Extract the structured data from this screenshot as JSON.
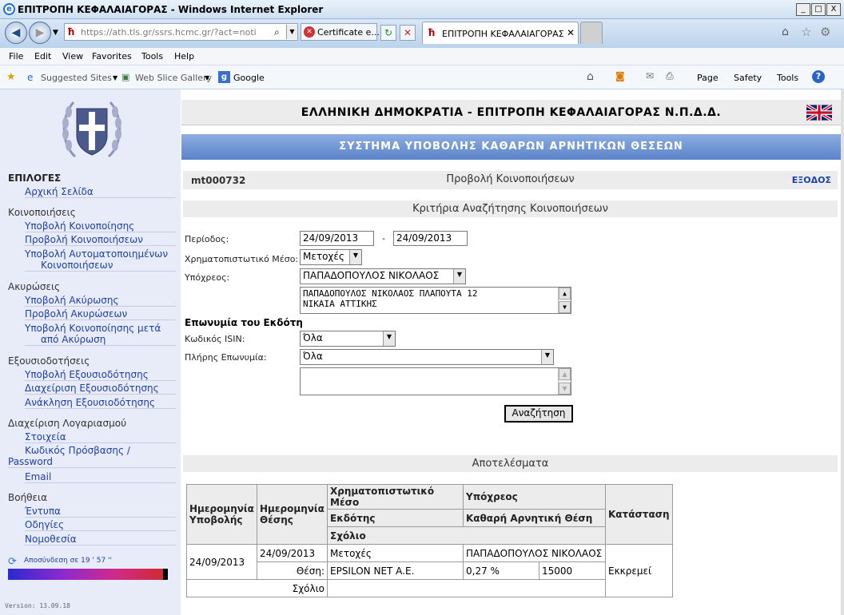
{
  "window": {
    "title": "ΕΠΙΤΡΟΠΗ ΚΕΦΑΛΑΙΑΓΟΡΑΣ - Windows Internet Explorer",
    "minimize": "_",
    "maximize": "□",
    "close": "X"
  },
  "browser": {
    "address": "https://ath.tls.gr/ssrs.hcmc.gr/?act=notification_",
    "certificate_label": "Certificate e...",
    "tab_label": "ΕΠΙΤΡΟΠΗ ΚΕΦΑΛΑΙΑΓΟΡΑΣ",
    "menu": [
      "File",
      "Edit",
      "View",
      "Favorites",
      "Tools",
      "Help"
    ],
    "favorites": [
      "Suggested Sites",
      "Web Slice Gallery",
      "Google"
    ],
    "toolbar": [
      "Page",
      "Safety",
      "Tools"
    ]
  },
  "site": {
    "banner": "ΕΛΛΗΝΙΚΗ ΔΗΜΟΚΡΑΤΙΑ - ΕΠΙΤΡΟΠΗ ΚΕΦΑΛΑΙΑΓΟΡΑΣ Ν.Π.Δ.Δ.",
    "system_title": "ΣΥΣΤΗΜΑ ΥΠΟΒΟΛΗΣ ΚΑΘΑΡΩΝ ΑΡΝΗΤΙΚΩΝ ΘΕΣΕΩΝ"
  },
  "sidebar": {
    "heading": "ΕΠΙΛΟΓΕΣ",
    "home": "Αρχική Σελίδα",
    "notifications_head": "Κοινοποιήσεις",
    "notif_submit": "Υποβολή Κοινοποίησης",
    "notif_view": "Προβολή Κοινοποιήσεων",
    "notif_auto_1": "Υποβολή Αυτοματοποιημένων",
    "notif_auto_2": "Κοινοποιήσεων",
    "cancel_head": "Ακυρώσεις",
    "cancel_submit": "Υποβολή Ακύρωσης",
    "cancel_view": "Προβολή Ακυρώσεων",
    "cancel_after_1": "Υποβολή Κοινοποίησης μετά",
    "cancel_after_2": "από Ακύρωση",
    "auth_head": "Εξουσιοδοτήσεις",
    "auth_submit": "Υποβολή Εξουσιοδότησης",
    "auth_manage": "Διαχείριση Εξουσιοδότησης",
    "auth_revoke": "Ανάκληση Εξουσιοδότησης",
    "account_head": "Διαχείριση Λογαριασμού",
    "account_info": "Στοιχεία",
    "account_pwd_1": "Κωδικός Πρόσβασης /",
    "account_pwd_2": "Password",
    "account_email": "Email",
    "help_head": "Βοήθεια",
    "help_forms": "Έντυπα",
    "help_guides": "Οδηγίες",
    "help_law": "Νομοθεσία",
    "logout_timer": "Αποσύνδεση σε 19 ' 57 ''",
    "version": "Version: 13.09.18"
  },
  "page": {
    "user_code": "mt000732",
    "title": "Προβολή Κοινοποιήσεων",
    "logout": "ΕΞΟΔΟΣ",
    "criteria_title": "Κριτήρια Αναζήτησης Κοινοποιήσεων",
    "results_title": "Αποτελέσματα"
  },
  "form": {
    "period_label": "Περίοδος:",
    "date_from": "24/09/2013",
    "date_sep": "-",
    "date_to": "24/09/2013",
    "instrument_label": "Χρηματοπιστωτικό Μέσο:",
    "instrument_value": "Μετοχές",
    "obligor_label": "Υπόχρεος:",
    "obligor_value": "ΠΑΠΑΔΟΠΟΥΛΟΣ ΝΙΚΟΛΑΟΣ",
    "obligor_info_1": "ΠΑΠΑΔΟΠΟΥΛΟΣ  ΝΙΚΟΛΑΟΣ ΠΛΑΠΟΥΤΑ 12",
    "obligor_info_2": "ΝΙΚΑΙΑ ΑΤΤΙΚΗΣ",
    "issuer_heading": "Επωνυμία του Εκδότη",
    "isin_label": "Κωδικός ISIN:",
    "isin_value": "Όλα",
    "fullname_label": "Πλήρης Επωνυμία:",
    "fullname_value": "Όλα",
    "search_button": "Αναζήτηση"
  },
  "results": {
    "headers": {
      "submission_date": "Ημερομηνία Υποβολής",
      "position_date": "Ημερομηνία Θέσης",
      "instrument": "Χρηματοπιστωτικό Μέσο",
      "obligor": "Υπόχρεος",
      "issuer": "Εκδότης",
      "net_short": "Καθαρή Αρνητική Θέση",
      "comment": "Σχόλιο",
      "status": "Κατάσταση"
    },
    "row": {
      "submission_date": "24/09/2013",
      "position_date": "24/09/2013",
      "instrument": "Μετοχές",
      "obligor": "ΠΑΠΑΔΟΠΟΥΛΟΣ ΝΙΚΟΛΑΟΣ",
      "position_label": "Θέση:",
      "issuer": "EPSILON NET A.E.",
      "percent": "0,27 %",
      "shares": "15000",
      "comment_label": "Σχόλιο",
      "status": "Εκκρεμεί"
    }
  }
}
